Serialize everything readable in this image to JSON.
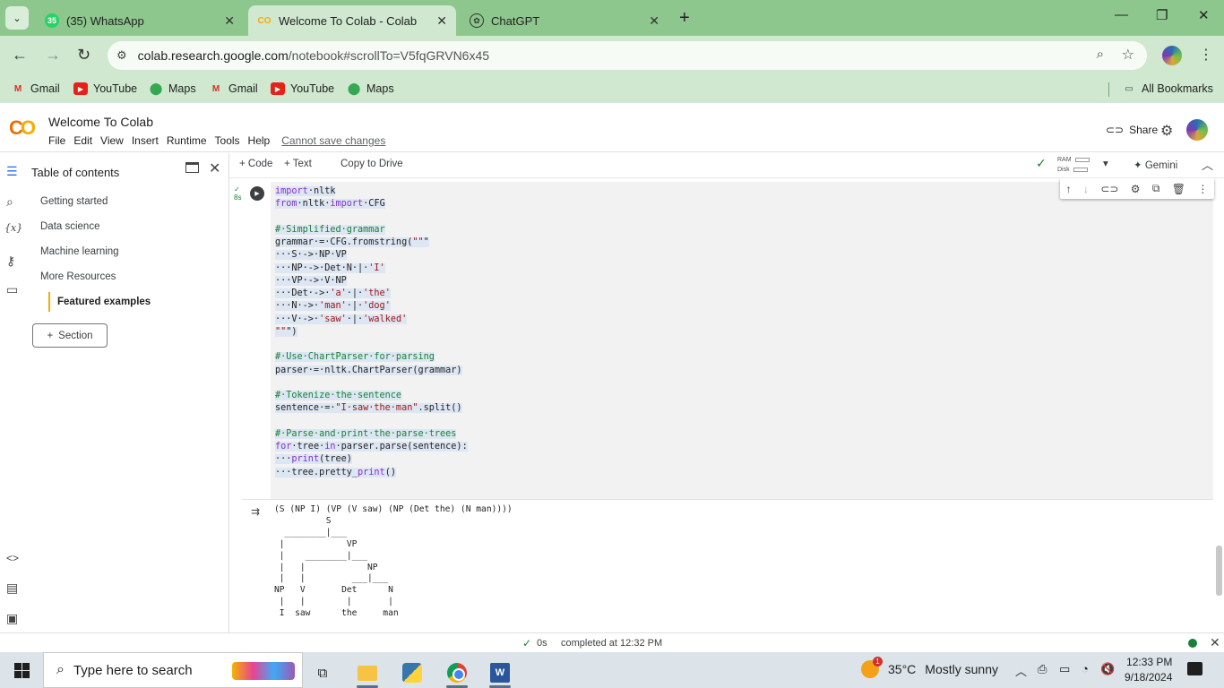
{
  "browser": {
    "tabs": [
      {
        "title": "(35) WhatsApp",
        "badge": "35",
        "favicon": "whatsapp-icon"
      },
      {
        "title": "Welcome To Colab - Colab",
        "favicon": "colab-icon"
      },
      {
        "title": "ChatGPT",
        "favicon": "chatgpt-icon"
      }
    ],
    "url_host": "colab.research.google.com",
    "url_path": "/notebook#scrollTo=V5fqGRVN6x45",
    "bookmarks": [
      "Gmail",
      "YouTube",
      "Maps",
      "Gmail",
      "YouTube",
      "Maps"
    ],
    "all_bookmarks": "All Bookmarks"
  },
  "colab": {
    "logo": "CO",
    "title": "Welcome To Colab",
    "menu": [
      "File",
      "Edit",
      "View",
      "Insert",
      "Runtime",
      "Tools",
      "Help"
    ],
    "cannot_save": "Cannot save changes",
    "share": "Share"
  },
  "sidebar": {
    "heading": "Table of contents",
    "items": [
      "Getting started",
      "Data science",
      "Machine learning",
      "More Resources"
    ],
    "active_item": "Featured examples",
    "section_button": "Section"
  },
  "toolbar": {
    "code": "Code",
    "text": "Text",
    "copy_to_drive": "Copy to Drive",
    "ram": "RAM",
    "disk": "Disk",
    "gemini": "Gemini"
  },
  "cell": {
    "exec_time": "8s",
    "code_lines": [
      "import·nltk",
      "from·nltk·import·CFG",
      "",
      "#·Simplified·grammar",
      "grammar·=·CFG.fromstring(\"\"\"",
      "···S·->·NP·VP",
      "···NP·->·Det·N·|·'I'",
      "···VP·->·V·NP",
      "···Det·->·'a'·|·'the'",
      "···N·->·'man'·|·'dog'",
      "···V·->·'saw'·|·'walked'",
      "\"\"\")",
      "",
      "#·Use·ChartParser·for·parsing",
      "parser·=·nltk.ChartParser(grammar)",
      "",
      "#·Tokenize·the·sentence",
      "sentence·=·\"I·saw·the·man\".split()",
      "",
      "#·Parse·and·print·the·parse·trees",
      "for·tree·in·parser.parse(sentence):",
      "···print(tree)",
      "···tree.pretty_print()"
    ],
    "output_lines": [
      "(S (NP I) (VP (V saw) (NP (Det the) (N man))))",
      "          S",
      "  ________|___",
      " |            VP",
      " |    ________|___",
      " |   |            NP",
      " |   |         ___|___",
      "NP   V       Det      N",
      " |   |        |       |",
      " I  saw      the     man"
    ]
  },
  "status": {
    "time": "0s",
    "completed": "completed at 12:32 PM"
  },
  "taskbar": {
    "search_placeholder": "Type here to search",
    "weather_temp": "35°C",
    "weather_cond": "Mostly sunny",
    "weather_badge": "1",
    "time": "12:33 PM",
    "date": "9/18/2024"
  }
}
